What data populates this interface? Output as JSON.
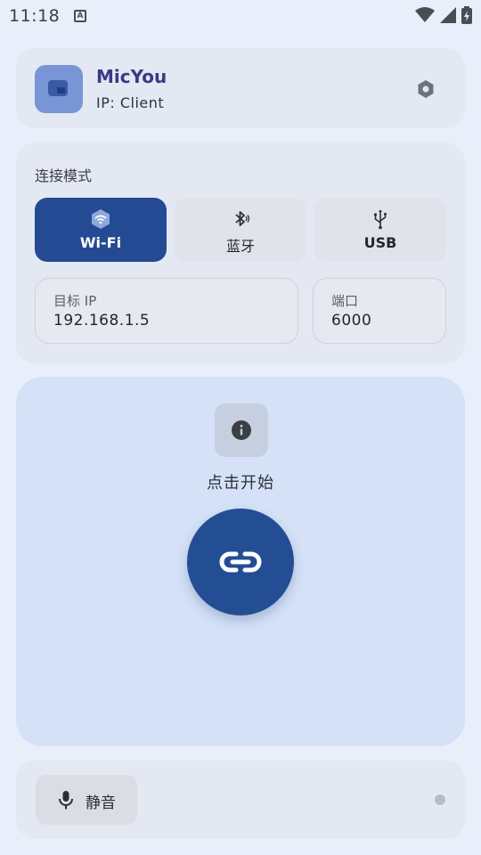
{
  "status_bar": {
    "time": "11:18",
    "notification_glyph": "A"
  },
  "header": {
    "app_name": "MicYou",
    "ip_text": "IP:  Client"
  },
  "connection": {
    "title": "连接模式",
    "modes": [
      {
        "label": "Wi-Fi",
        "icon": "wifi-icon",
        "active": true
      },
      {
        "label": "蓝牙",
        "icon": "bluetooth-icon",
        "active": false
      },
      {
        "label": "USB",
        "icon": "usb-icon",
        "active": false
      }
    ],
    "target_ip": {
      "label": "目标 IP",
      "value": "192.168.1.5"
    },
    "port": {
      "label": "端口",
      "value": "6000"
    }
  },
  "main": {
    "hint": "点击开始"
  },
  "bottom": {
    "mute_label": "静音"
  },
  "colors": {
    "accent": "#244e94",
    "background": "#e8effa",
    "main_panel": "#d4e1f7"
  }
}
